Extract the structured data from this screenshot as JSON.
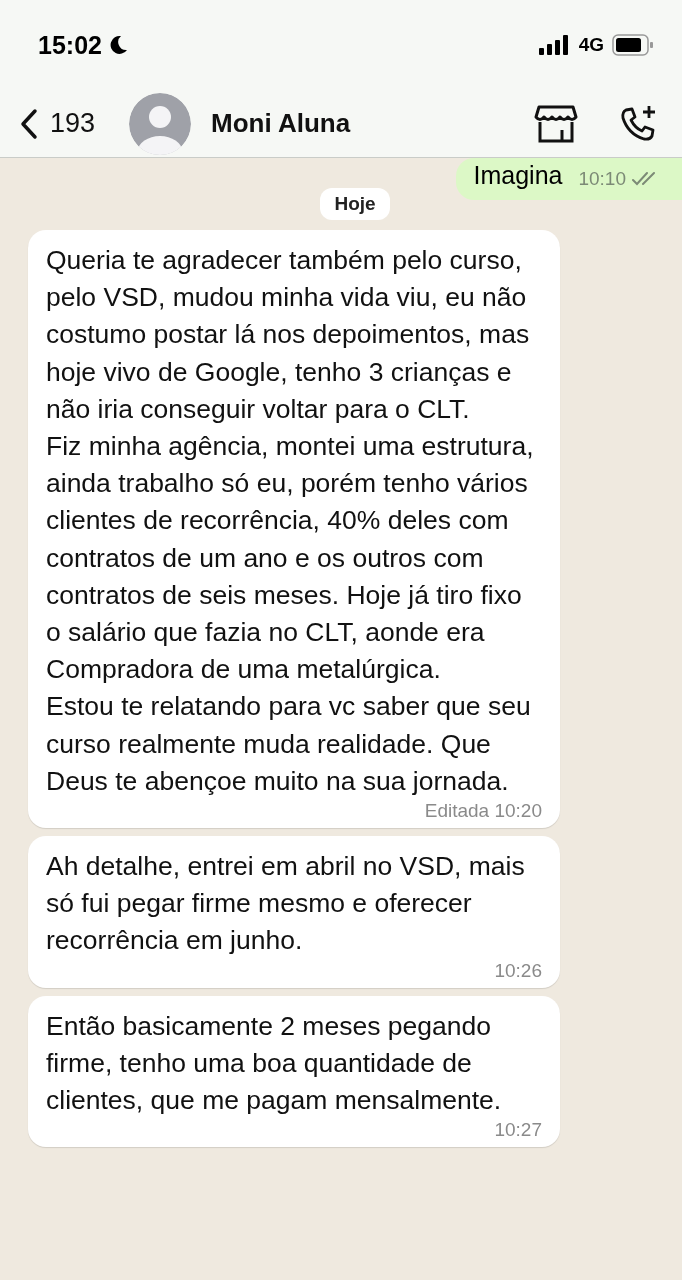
{
  "status_bar": {
    "time": "15:02",
    "network": "4G"
  },
  "header": {
    "back_count": "193",
    "contact_name": "Moni Aluna"
  },
  "messages": [
    {
      "kind": "outgoing",
      "text": "Imagina",
      "time": "10:10"
    },
    {
      "kind": "date",
      "text": "Hoje"
    },
    {
      "kind": "incoming",
      "text": "Queria te agradecer também pelo curso, pelo VSD, mudou minha vida viu, eu não costumo postar lá nos depoimentos, mas hoje vivo de Google, tenho 3 crianças e não iria conseguir voltar para o CLT.\nFiz minha agência, montei uma estrutura, ainda trabalho só eu, porém tenho vários clientes de recorrência, 40% deles com contratos de um ano e os outros com contratos de seis meses. Hoje já tiro fixo o salário que fazia no CLT, aonde era Compradora de uma metalúrgica.\nEstou te relatando para vc saber que seu curso realmente muda realidade. Que Deus te abençoe muito na sua jornada.",
      "time": "Editada 10:20"
    },
    {
      "kind": "incoming",
      "text": "Ah detalhe, entrei em abril no VSD, mais só fui pegar firme mesmo e oferecer recorrência em junho.",
      "time": "10:26"
    },
    {
      "kind": "incoming",
      "text": "Então basicamente 2 meses pegando firme, tenho uma boa quantidade de clientes, que me pagam mensalmente.",
      "time": "10:27"
    }
  ]
}
